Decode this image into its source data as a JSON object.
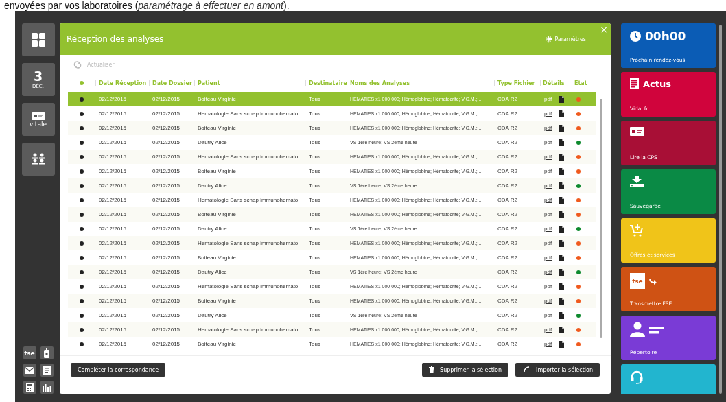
{
  "intro": {
    "text": "envoyées par vos laboratoires (",
    "link": "paramétrage à effectuer en amont",
    "tail": ")."
  },
  "sidebar": {
    "tiles": [
      {
        "kind": "apps"
      },
      {
        "kind": "date",
        "day": "3",
        "month": "DÉC."
      },
      {
        "kind": "card",
        "label": "vitale"
      },
      {
        "kind": "people"
      }
    ],
    "small_icons": [
      {
        "kind": "fse",
        "label": "fse"
      },
      {
        "kind": "phone"
      },
      {
        "kind": "mail"
      },
      {
        "kind": "note"
      },
      {
        "kind": "calculator"
      },
      {
        "kind": "chart"
      }
    ]
  },
  "panel": {
    "title": "Réception des analyses",
    "settings": "Paramètres",
    "close": "×",
    "refresh": "Actualiser",
    "columns": [
      "Date Réception",
      "Date Dossier",
      "Patient",
      "Destinataire",
      "Noms des Analyses",
      "Type Fichier",
      "Détails",
      "Etat"
    ],
    "rows": [
      {
        "selected": true,
        "date_reception": "02/12/2015",
        "date_dossier": "02/12/2015",
        "patient": "Boiteau Virginie",
        "destinataire": "Tous",
        "analyses": "HEMATIES x1 000 000; Hémoglobine; Hématocrite; V.G.M.;...",
        "type": "CDA R2",
        "details": "pdf",
        "color": "#f05a1e"
      },
      {
        "selected": false,
        "date_reception": "02/12/2015",
        "date_dossier": "02/12/2015",
        "patient": "Hematologie Sans schap immunohemato",
        "destinataire": "Tous",
        "analyses": "HEMATIES x1 000 000; Hémoglobine; Hématocrite; V.G.M.;...",
        "type": "CDA R2",
        "details": "pdf",
        "color": "#f05a1e"
      },
      {
        "selected": false,
        "date_reception": "02/12/2015",
        "date_dossier": "02/12/2015",
        "patient": "Boiteau Virginie",
        "destinataire": "Tous",
        "analyses": "HEMATIES x1 000 000; Hémoglobine; Hématocrite; V.G.M.;...",
        "type": "CDA R2",
        "details": "pdf",
        "color": "#f05a1e"
      },
      {
        "selected": false,
        "date_reception": "02/12/2015",
        "date_dossier": "02/12/2015",
        "patient": "Dautry Alice",
        "destinataire": "Tous",
        "analyses": "VS 1ère heure; VS 2ème heure",
        "type": "CDA R2",
        "details": "pdf",
        "color": "#0e8a2e"
      },
      {
        "selected": false,
        "date_reception": "02/12/2015",
        "date_dossier": "02/12/2015",
        "patient": "Hematologie Sans schap immunohemato",
        "destinataire": "Tous",
        "analyses": "HEMATIES x1 000 000; Hémoglobine; Hématocrite; V.G.M.;...",
        "type": "CDA R2",
        "details": "pdf",
        "color": "#f05a1e"
      },
      {
        "selected": false,
        "date_reception": "02/12/2015",
        "date_dossier": "02/12/2015",
        "patient": "Boiteau Virginie",
        "destinataire": "Tous",
        "analyses": "HEMATIES x1 000 000; Hémoglobine; Hématocrite; V.G.M.;...",
        "type": "CDA R2",
        "details": "pdf",
        "color": "#f05a1e"
      },
      {
        "selected": false,
        "date_reception": "02/12/2015",
        "date_dossier": "02/12/2015",
        "patient": "Dautry Alice",
        "destinataire": "Tous",
        "analyses": "VS 1ère heure; VS 2ème heure",
        "type": "CDA R2",
        "details": "pdf",
        "color": "#0e8a2e"
      },
      {
        "selected": false,
        "date_reception": "02/12/2015",
        "date_dossier": "02/12/2015",
        "patient": "Hematologie Sans schap immunohemato",
        "destinataire": "Tous",
        "analyses": "HEMATIES x1 000 000; Hémoglobine; Hématocrite; V.G.M.;...",
        "type": "CDA R2",
        "details": "pdf",
        "color": "#f05a1e"
      },
      {
        "selected": false,
        "date_reception": "02/12/2015",
        "date_dossier": "02/12/2015",
        "patient": "Boiteau Virginie",
        "destinataire": "Tous",
        "analyses": "HEMATIES x1 000 000; Hémoglobine; Hématocrite; V.G.M.;...",
        "type": "CDA R2",
        "details": "pdf",
        "color": "#f05a1e"
      },
      {
        "selected": false,
        "date_reception": "02/12/2015",
        "date_dossier": "02/12/2015",
        "patient": "Dautry Alice",
        "destinataire": "Tous",
        "analyses": "VS 1ère heure; VS 2ème heure",
        "type": "CDA R2",
        "details": "pdf",
        "color": "#0e8a2e"
      },
      {
        "selected": false,
        "date_reception": "02/12/2015",
        "date_dossier": "02/12/2015",
        "patient": "Hematologie Sans schap immunohemato",
        "destinataire": "Tous",
        "analyses": "HEMATIES x1 000 000; Hémoglobine; Hématocrite; V.G.M.;...",
        "type": "CDA R2",
        "details": "pdf",
        "color": "#f05a1e"
      },
      {
        "selected": false,
        "date_reception": "02/12/2015",
        "date_dossier": "02/12/2015",
        "patient": "Boiteau Virginie",
        "destinataire": "Tous",
        "analyses": "HEMATIES x1 000 000; Hémoglobine; Hématocrite; V.G.M.;...",
        "type": "CDA R2",
        "details": "pdf",
        "color": "#f05a1e"
      },
      {
        "selected": false,
        "date_reception": "02/12/2015",
        "date_dossier": "02/12/2015",
        "patient": "Dautry Alice",
        "destinataire": "Tous",
        "analyses": "VS 1ère heure; VS 2ème heure",
        "type": "CDA R2",
        "details": "pdf",
        "color": "#0e8a2e"
      },
      {
        "selected": false,
        "date_reception": "02/12/2015",
        "date_dossier": "02/12/2015",
        "patient": "Hematologie Sans schap immunohemato",
        "destinataire": "Tous",
        "analyses": "HEMATIES x1 000 000; Hémoglobine; Hématocrite; V.G.M.;...",
        "type": "CDA R2",
        "details": "pdf",
        "color": "#f05a1e"
      },
      {
        "selected": false,
        "date_reception": "02/12/2015",
        "date_dossier": "02/12/2015",
        "patient": "Boiteau Virginie",
        "destinataire": "Tous",
        "analyses": "HEMATIES x1 000 000; Hémoglobine; Hématocrite; V.G.M.;...",
        "type": "CDA R2",
        "details": "pdf",
        "color": "#f05a1e"
      },
      {
        "selected": false,
        "date_reception": "02/12/2015",
        "date_dossier": "02/12/2015",
        "patient": "Dautry Alice",
        "destinataire": "Tous",
        "analyses": "VS 1ère heure; VS 2ème heure",
        "type": "CDA R2",
        "details": "pdf",
        "color": "#0e8a2e"
      },
      {
        "selected": false,
        "date_reception": "02/12/2015",
        "date_dossier": "02/12/2015",
        "patient": "Hematologie Sans schap immunohemato",
        "destinataire": "Tous",
        "analyses": "HEMATIES x1 000 000; Hémoglobine; Hématocrite; V.G.M.;...",
        "type": "CDA R2",
        "details": "pdf",
        "color": "#f05a1e"
      },
      {
        "selected": false,
        "date_reception": "02/12/2015",
        "date_dossier": "02/12/2015",
        "patient": "Boiteau Virginie",
        "destinataire": "Tous",
        "analyses": "HEMATIES x1 000 000; Hémoglobine; Hématocrite; V.G.M.;...",
        "type": "CDA R2",
        "details": "pdf",
        "color": "#f05a1e"
      }
    ],
    "buttons": [
      {
        "kind": "plain",
        "label": "Compléter la correspondance"
      },
      {
        "kind": "delete",
        "label": "Supprimer la sélection"
      },
      {
        "kind": "import",
        "label": "Importer la sélection"
      }
    ]
  },
  "tiles": [
    {
      "kind": "clock",
      "title": "00h00",
      "label": "Prochain rendez-vous",
      "color": "#0b5cb5"
    },
    {
      "kind": "news",
      "title": "Actus",
      "label": "Vidal.fr",
      "color": "#d0043c"
    },
    {
      "kind": "card",
      "label": "Lire la CPS",
      "color": "#a80f36"
    },
    {
      "kind": "download",
      "label": "Sauvegarde",
      "color": "#0a8a45"
    },
    {
      "kind": "cart",
      "label": "Offres et services",
      "color": "#f0c419"
    },
    {
      "kind": "fse",
      "icon_text": "fse",
      "label": "Transmettre FSE",
      "color": "#cf5214"
    },
    {
      "kind": "contacts",
      "label": "Répertoire",
      "color": "#7a3bd6"
    },
    {
      "kind": "headset",
      "color": "#22b5cf"
    }
  ]
}
